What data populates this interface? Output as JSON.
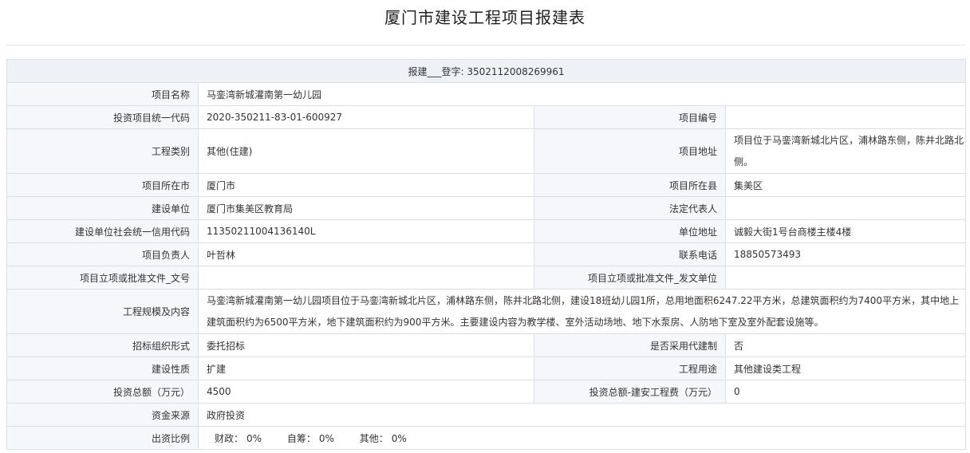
{
  "title": "厦门市建设工程项目报建表",
  "register": {
    "label": "报建___登字:",
    "number": "3502112008269961"
  },
  "rows": {
    "project_name": {
      "label": "项目名称",
      "value": "马銮湾新城灌南第一幼儿园"
    },
    "invest_code": {
      "label": "投资项目统一代码",
      "value": "2020-350211-83-01-600927"
    },
    "project_no": {
      "label": "项目编号",
      "value": ""
    },
    "eng_type": {
      "label": "工程类别",
      "value": "其他(住建)"
    },
    "address": {
      "label": "项目地址",
      "value": "项目位于马銮湾新城北片区，浦林路东侧，陈井北路北侧。"
    },
    "city": {
      "label": "项目所在市",
      "value": "厦门市"
    },
    "county": {
      "label": "项目所在县",
      "value": "集美区"
    },
    "builder": {
      "label": "建设单位",
      "value": "厦门市集美区教育局"
    },
    "legal_rep": {
      "label": "法定代表人",
      "value": ""
    },
    "credit_code": {
      "label": "建设单位社会统一信用代码",
      "value": "11350211004136140L"
    },
    "unit_addr": {
      "label": "单位地址",
      "value": "诚毅大街1号台商楼主楼4楼"
    },
    "manager": {
      "label": "项目负责人",
      "value": "叶哲林"
    },
    "phone": {
      "label": "联系电话",
      "value": "18850573493"
    },
    "approval_no": {
      "label": "项目立项或批准文件_文号",
      "value": ""
    },
    "approval_unit": {
      "label": "项目立项或批准文件_发文单位",
      "value": ""
    },
    "scale": {
      "label": "工程规模及内容",
      "value": "马銮湾新城灌南第一幼儿园项目位于马銮湾新城北片区，浦林路东侧，陈井北路北侧，建设18班幼儿园1所，总用地面积6247.22平方米，总建筑面积约为7400平方米，其中地上建筑面积约为6500平方米，地下建筑面积约为900平方米。主要建设内容为教学楼、室外活动场地、地下水泵房、人防地下室及室外配套设施等。"
    },
    "tender": {
      "label": "招标组织形式",
      "value": "委托招标"
    },
    "agent": {
      "label": "是否采用代建制",
      "value": "否"
    },
    "nature": {
      "label": "建设性质",
      "value": "扩建"
    },
    "usage": {
      "label": "工程用途",
      "value": "其他建设类工程"
    },
    "invest_total": {
      "label": "投资总额（万元）",
      "value": "4500"
    },
    "install_fee": {
      "label": "投资总额-建安工程费（万元）",
      "value": "0"
    },
    "fund_source": {
      "label": "资金来源",
      "value": "政府投资"
    },
    "ratio": {
      "label": "出资比例",
      "finance_label": "财政：",
      "finance_value": "0%",
      "self_label": "自筹：",
      "self_value": "0%",
      "other_label": "其他：",
      "other_value": "0%"
    }
  }
}
